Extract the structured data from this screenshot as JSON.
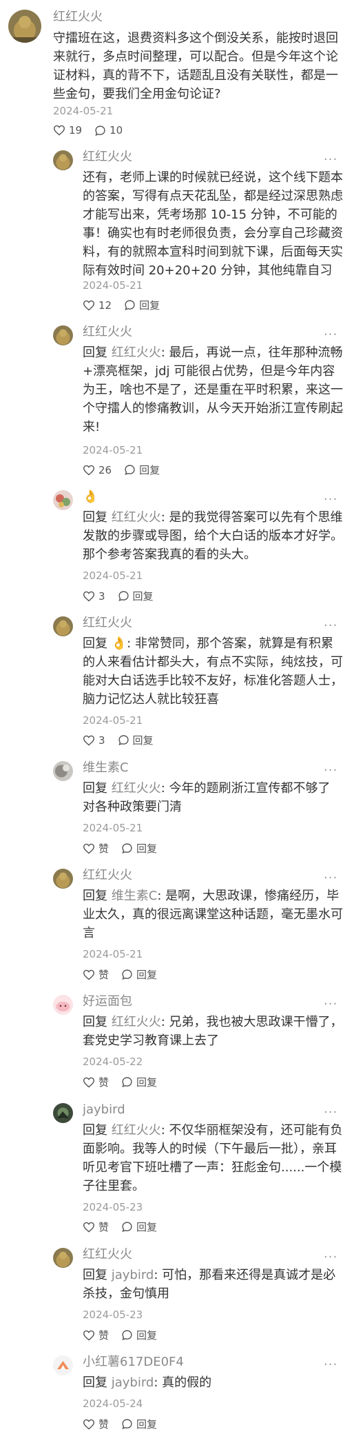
{
  "reply_prefix": "回复 ",
  "comments": [
    {
      "author": "红红火火",
      "more_label": "···",
      "text": "守擂班在这，退费资料多这个倒没关系，能按时退回来就行，多点时间整理，可以配合。但是今年这个论证材料，真的背不下，话题乱且没有关联性，都是一些金句，要我们全用金句论证?",
      "date": "2024-05-21",
      "likes": "19",
      "replies_label": "10"
    },
    {
      "author": "红红火火",
      "more_label": "···",
      "text": "还有，老师上课的时候就已经说，这个线下题本的答案，写得有点天花乱坠，都是经过深思熟虑才能写出来，凭考场那 10-15 分钟，不可能的事！确实也有时老师很负责，会分享自己珍藏资料，有的就照本宣科时间到就下课，后面每天实际有效时间 20+20+20 分钟，其他纯靠自习",
      "date": "2024-05-21",
      "likes": "12",
      "reply_label": "回复"
    },
    {
      "author": "红红火火",
      "more_label": "···",
      "reply_to": "红红火火",
      "text": ": 最后，再说一点，往年那种流畅+漂亮框架，jdj 可能很占优势，但是今年内容为王，啥也不是了，还是重在平时积累，来这一个守擂人的惨痛教训，从今天开始浙江宣传刷起来!",
      "date": "2024-05-21",
      "likes": "26",
      "reply_label": "回复"
    },
    {
      "author": "👌",
      "more_label": "···",
      "reply_to": "红红火火",
      "text": ": 是的我觉得答案可以先有个思维发散的步骤或导图，给个大白话的版本才好学。那个参考答案我真的看的头大。",
      "date": "2024-05-21",
      "likes": "3",
      "reply_label": "回复"
    },
    {
      "author": "红红火火",
      "more_label": "···",
      "reply_to": "👌",
      "text": ": 非常赞同，那个答案，就算是有积累的人来看估计都头大，有点不实际，纯炫技，可能对大白话选手比较不友好，标准化答题人士，脑力记忆达人就比较狂喜",
      "date": "2024-05-21",
      "likes": "3",
      "reply_label": "回复"
    },
    {
      "author": "维生素C",
      "more_label": "···",
      "reply_to": "红红火火",
      "text": ": 今年的题刷浙江宣传都不够了 对各种政策要门清",
      "date": "2024-05-21",
      "likes": "赞",
      "reply_label": "回复"
    },
    {
      "author": "红红火火",
      "more_label": "···",
      "reply_to": "维生素C",
      "text": ": 是啊，大思政课，惨痛经历，毕业太久，真的很远离课堂这种话题，毫无墨水可言",
      "date": "2024-05-21",
      "likes": "赞",
      "reply_label": "回复"
    },
    {
      "author": "好运面包",
      "more_label": "···",
      "reply_to": "红红火火",
      "text": ": 兄弟，我也被大思政课干懵了，套党史学习教育课上去了",
      "date": "2024-05-22",
      "likes": "赞",
      "reply_label": "回复"
    },
    {
      "author": "jaybird",
      "more_label": "···",
      "reply_to": "红红火火",
      "text": ": 不仅华丽框架没有，还可能有负面影响。我等人的时候（下午最后一批），亲耳听见考官下班吐槽了一声：狂彪金句......一个模子往里套。",
      "date": "2024-05-23",
      "likes": "赞",
      "reply_label": "回复"
    },
    {
      "author": "红红火火",
      "more_label": "···",
      "reply_to": "jaybird",
      "text": ": 可怕，那看来还得是真诚才是必杀技，金句慎用",
      "date": "2024-05-23",
      "likes": "赞",
      "reply_label": "回复"
    },
    {
      "author": "小红薯617DE0F4",
      "more_label": "···",
      "reply_to": "jaybird",
      "text": ": 真的假的",
      "date": "2024-05-24",
      "likes": "赞",
      "reply_label": "回复"
    }
  ]
}
